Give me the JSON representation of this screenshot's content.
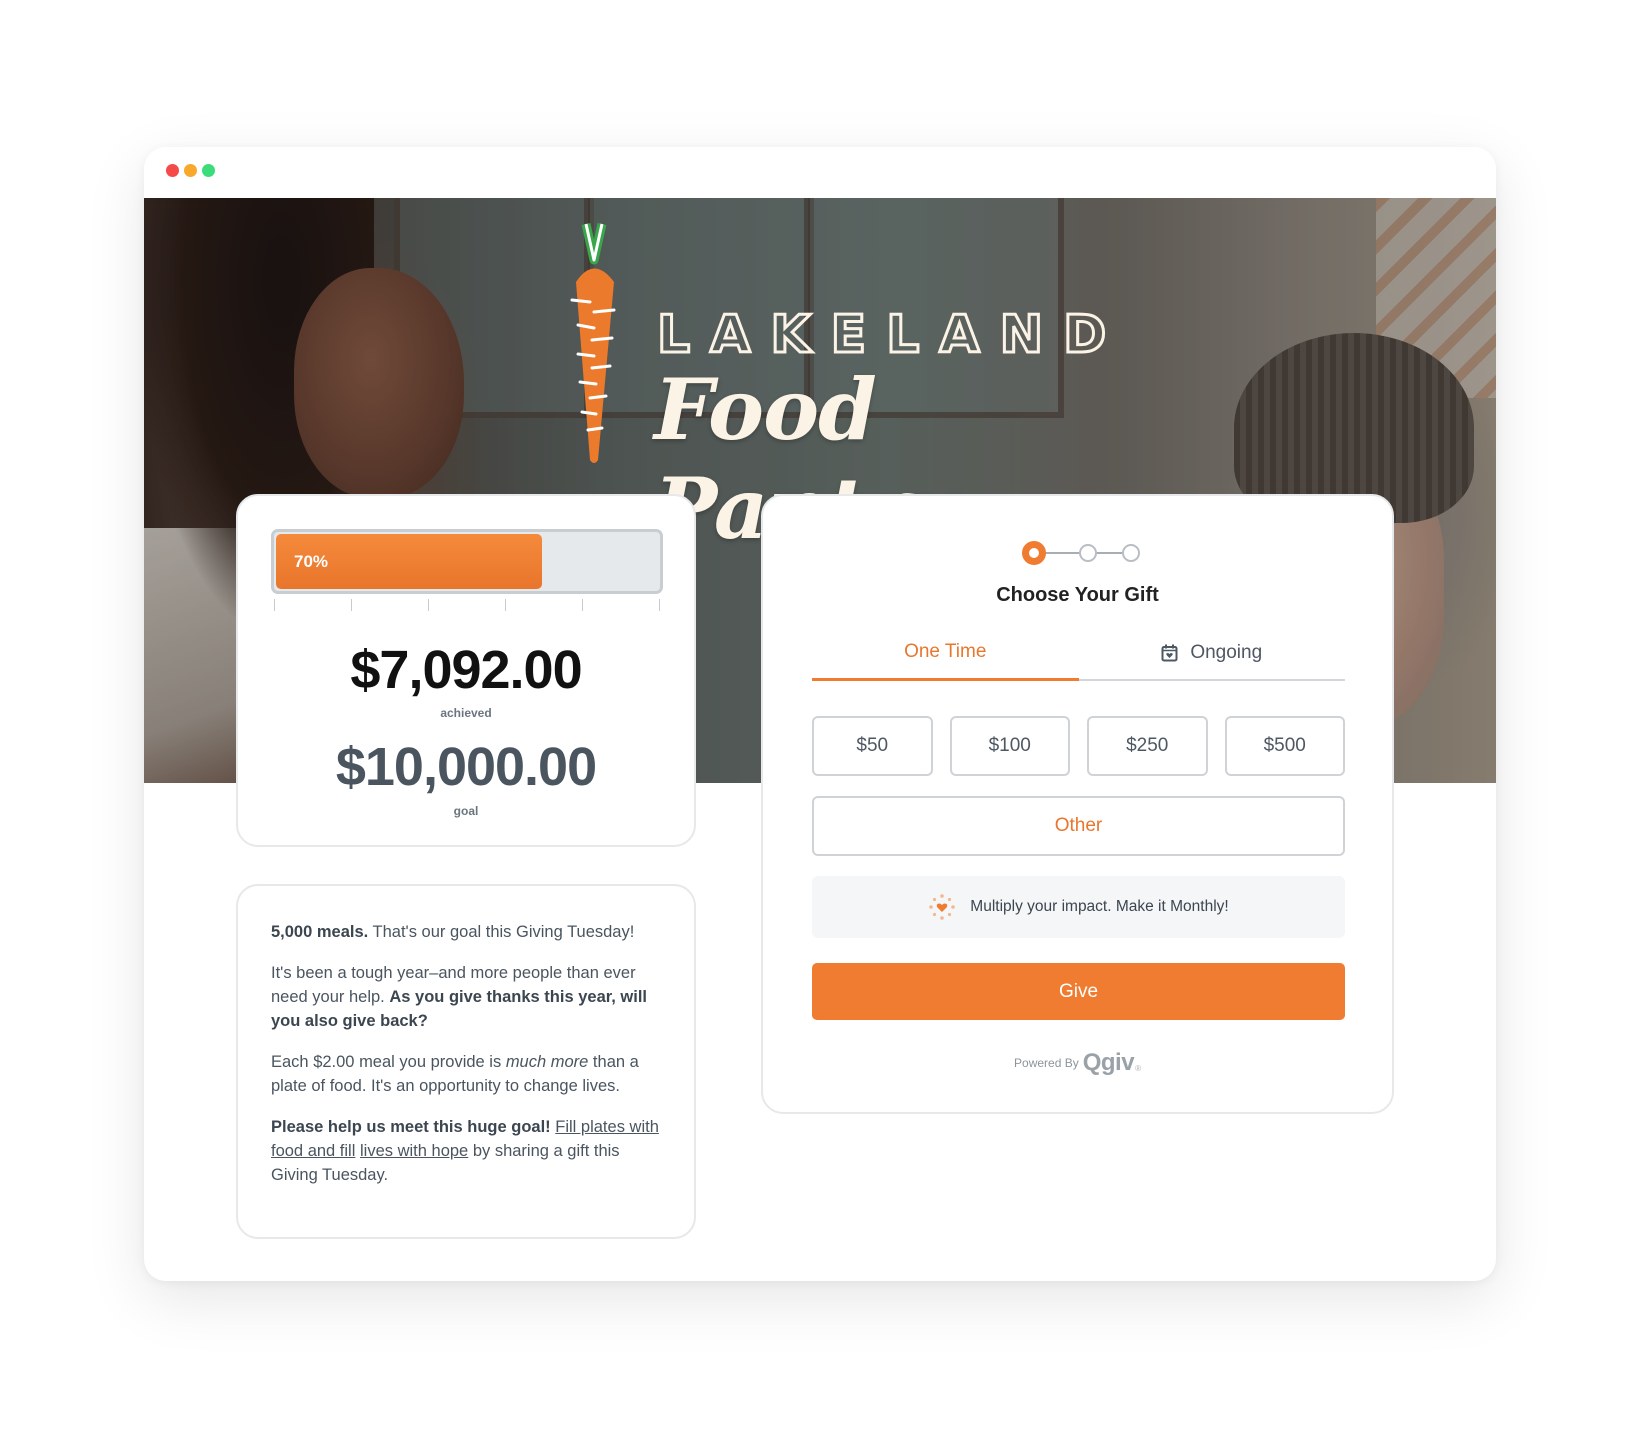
{
  "window": {
    "controls": [
      "close",
      "minimize",
      "maximize"
    ]
  },
  "hero": {
    "logo_line1": "LAKELAND",
    "logo_line2": "Food Pantry",
    "logo_icon": "carrot-icon"
  },
  "campaign": {
    "progress_percent": 70,
    "progress_label": "70%",
    "achieved_amount": "$7,092.00",
    "achieved_label": "achieved",
    "goal_amount": "$10,000.00",
    "goal_label": "goal"
  },
  "description": {
    "p1_bold": "5,000 meals.",
    "p1_rest": " That's our goal this Giving Tuesday!",
    "p2_start": "It's been a tough year–and more people than ever need your help. ",
    "p2_bold": "As you give thanks this year, will you also give back?",
    "p3_start": "Each $2.00 meal you provide is ",
    "p3_italic": "much more",
    "p3_end": " than a plate of food. It's an opportunity to change lives.",
    "p4_bold": "Please help us meet this huge goal!",
    "p4_link1": "Fill plates with food and fill",
    "p4_link2": "lives with hope",
    "p4_end": " by sharing a gift this Giving Tuesday."
  },
  "gift_form": {
    "steps": 3,
    "current_step": 1,
    "title": "Choose Your Gift",
    "tabs": [
      {
        "label": "One Time",
        "active": true
      },
      {
        "label": "Ongoing",
        "active": false,
        "icon": "calendar-heart-icon"
      }
    ],
    "amounts": [
      "$50",
      "$100",
      "$250",
      "$500"
    ],
    "other_label": "Other",
    "monthly_prompt": "Multiply your impact. Make it Monthly!",
    "give_label": "Give",
    "powered_by": "Powered By",
    "brand": "Qgiv",
    "brand_mark": "®"
  },
  "colors": {
    "accent": "#ef7c30",
    "text": "#3c4650",
    "border": "#cfd3d7"
  }
}
